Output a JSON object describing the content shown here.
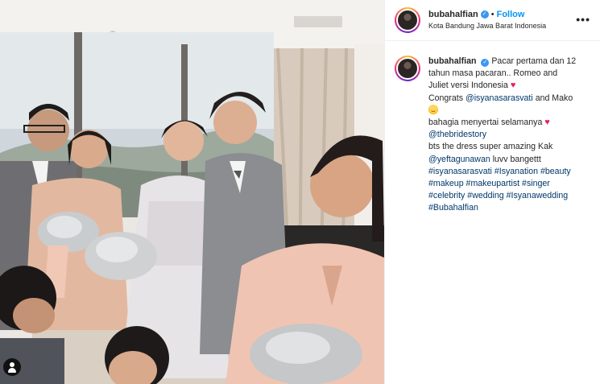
{
  "post": {
    "username": "bubahalfian",
    "separator": "•",
    "follow_label": "Follow",
    "location": "Kota Bandung Jawa Barat Indonesia",
    "more_label": "•••"
  },
  "icons": {
    "verified": "verified-badge-icon",
    "more": "more-options-icon",
    "heart": "red-heart-icon",
    "smile": "smiling-face-with-hearts-icon",
    "user_tag": "tagged-users-icon"
  },
  "colors": {
    "link": "#00376b",
    "follow": "#0095f6",
    "verified": "#3897f0",
    "heart": "#e0245e"
  },
  "caption": {
    "username": "bubahalfian",
    "line1": "Pacar pertama dan 12",
    "line2": "tahun masa pacaran.. Romeo and",
    "line3": "Juliet versi Indonesia",
    "line4_pre": "Congrats",
    "mention1": "@isyanasarasvati",
    "line4_post": "and Mako",
    "line5": "bahagia menyertai selamanya",
    "mention2": "@thebridestory",
    "line6": "bts the dress super amazing Kak",
    "mention3": "@yeftagunawan",
    "line7_post": "luvv bangettt",
    "hashtags_line1": [
      "#isyanasarasvati",
      "#Isyanation",
      "#beauty"
    ],
    "hashtags_line2": [
      "#makeup",
      "#makeupartist",
      "#singer"
    ],
    "hashtags_line3": [
      "#celebrity",
      "#wedding",
      "#Isyanawedding"
    ],
    "hashtags_line4": [
      "#Bubahalfian"
    ]
  }
}
